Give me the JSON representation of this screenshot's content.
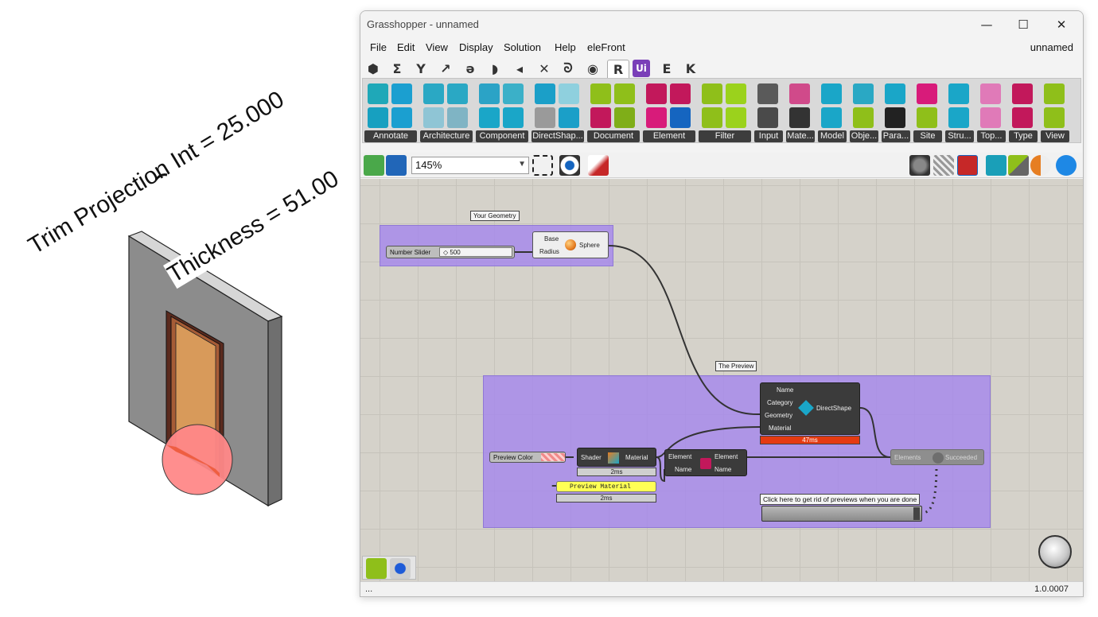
{
  "revit_view": {
    "label_trim": "Trim Projection Int = 25.000",
    "label_thickness": "Thickness = 51.00"
  },
  "window": {
    "title": "Grasshopper - unnamed",
    "document_name": "unnamed",
    "minimize": "—",
    "maximize": "☐",
    "close": "✕"
  },
  "menu": [
    "File",
    "Edit",
    "View",
    "Display",
    "Solution",
    "Help",
    "eleFront"
  ],
  "tabs": [
    "⬢",
    "Σ",
    "Y",
    "↗",
    "ә",
    "◗",
    "◂",
    "✕",
    "ᘐ",
    "◉",
    "R",
    "Ui",
    "E",
    "K"
  ],
  "ribbon_groups": [
    "Annotate",
    "Architecture",
    "Component",
    "DirectShap...",
    "Document",
    "Element",
    "Filter",
    "Input",
    "Mate...",
    "Model",
    "Obje...",
    "Para...",
    "Site",
    "Stru...",
    "Top...",
    "Type",
    "View"
  ],
  "toolbar": {
    "zoom": "145%"
  },
  "canvas": {
    "group_geometry_label": "Your Geometry",
    "group_preview_label": "The Preview",
    "number_slider_label": "Number Slider",
    "number_slider_value": "◇ 500",
    "sphere": {
      "in_base": "Base",
      "in_radius": "Radius",
      "name": "Sphere"
    },
    "directshape": {
      "in_name": "Name",
      "in_category": "Category",
      "in_geometry": "Geometry",
      "in_material": "Material",
      "name": "DirectShape",
      "time": "47ms"
    },
    "preview_color_label": "Preview Color",
    "shader": {
      "in": "Shader",
      "out": "Material",
      "time": "2ms"
    },
    "preview_material": {
      "text": "Preview Material",
      "time": "2ms"
    },
    "element": {
      "in_element": "Element",
      "in_name": "Name",
      "out_element": "Element",
      "out_name": "Name"
    },
    "delete_comp": {
      "in": "Elements",
      "out": "Succeeded"
    },
    "panel_note": "Click here to get rid of previews when you are done"
  },
  "status": {
    "left": "...",
    "version": "1.0.0007"
  },
  "colors": {
    "canvas_bg": "#d5d2ca",
    "group_fill": "#a587eb",
    "component_dark": "#3b3b3b",
    "time_red": "#e53a12",
    "yellow_panel": "#ffff55",
    "wall_gray": "#8a8a8a",
    "door_orange": "#d89a5a",
    "sphere_red": "#ff8888"
  }
}
